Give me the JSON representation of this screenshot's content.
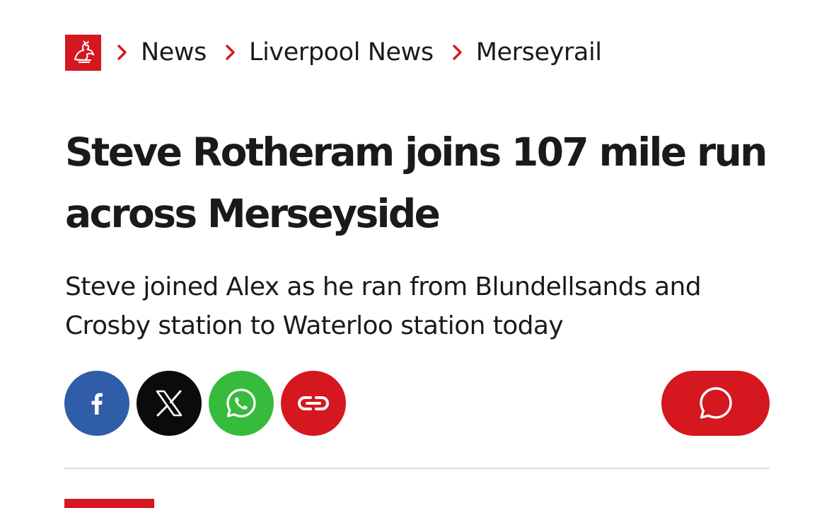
{
  "breadcrumb": {
    "logo_icon": "liver-bird-logo-icon",
    "items": [
      {
        "label": "News"
      },
      {
        "label": "Liverpool News"
      },
      {
        "label": "Merseyrail"
      }
    ],
    "separator_icon": "chevron-right-icon",
    "separator_color": "#d5171f"
  },
  "article": {
    "headline": "Steve Rotheram joins 107 mile run across Merseyside",
    "standfirst": "Steve joined Alex as he ran from Blundellsands and Crosby station to Waterloo station today"
  },
  "share": {
    "buttons": [
      {
        "icon": "facebook-icon",
        "color": "#2f5da8"
      },
      {
        "icon": "x-icon",
        "color": "#0b0b0b"
      },
      {
        "icon": "whatsapp-icon",
        "color": "#37bb3d"
      },
      {
        "icon": "link-icon",
        "color": "#d5171f"
      }
    ],
    "comments_icon": "comment-bubble-icon",
    "comments_color": "#d5171f"
  },
  "colors": {
    "accent": "#d5171f",
    "text": "#1a1a1a",
    "divider": "#dcdcdc"
  }
}
